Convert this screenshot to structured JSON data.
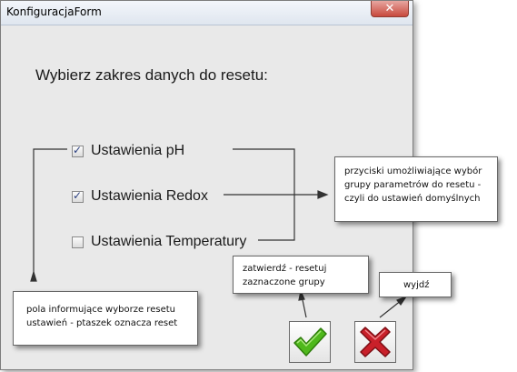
{
  "window": {
    "title": "KonfiguracjaForm"
  },
  "heading": "Wybierz zakres danych do resetu:",
  "checkboxes": [
    {
      "label": "Ustawienia pH",
      "checked": true
    },
    {
      "label": "Ustawienia Redox",
      "checked": true
    },
    {
      "label": "Ustawienia Temperatury",
      "checked": false
    }
  ],
  "callouts": {
    "groups": "przyciski umożliwiające wybór grupy parametrów do resetu - czyli do ustawień domyślnych",
    "info": "pola informujące wyborze resetu ustawień - ptaszek oznacza reset",
    "confirm": "zatwierdź - resetuj zaznaczone grupy",
    "exit": "wyjdź"
  },
  "buttons": {
    "confirm_icon": "green-check-icon",
    "exit_icon": "red-x-icon"
  },
  "colors": {
    "check_green": "#4fb81c",
    "cross_red": "#c9202a",
    "window_bg": "#e9e9e9"
  }
}
